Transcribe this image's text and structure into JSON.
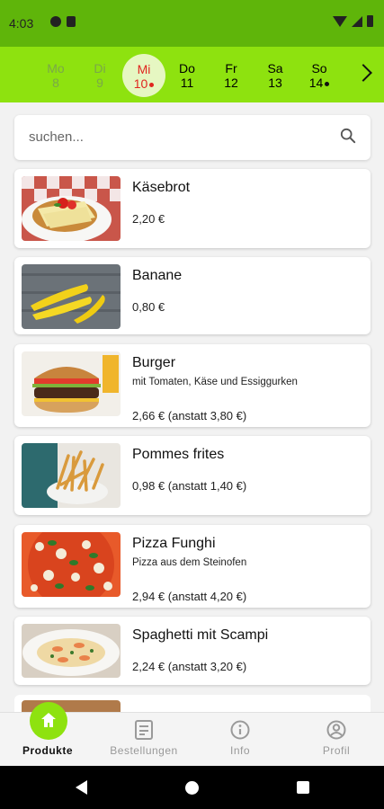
{
  "status_bar": {
    "time": "4:03"
  },
  "date_bar": {
    "days": [
      {
        "name": "Mo",
        "num": "8",
        "state": "past"
      },
      {
        "name": "Di",
        "num": "9",
        "state": "past"
      },
      {
        "name": "Mi",
        "num": "10",
        "state": "active",
        "dot_color": "#e0261f"
      },
      {
        "name": "Do",
        "num": "11",
        "state": "normal"
      },
      {
        "name": "Fr",
        "num": "12",
        "state": "normal"
      },
      {
        "name": "Sa",
        "num": "13",
        "state": "normal"
      },
      {
        "name": "So",
        "num": "14",
        "state": "normal",
        "dot_color": "#111111"
      }
    ]
  },
  "search": {
    "placeholder": "suchen..."
  },
  "products": [
    {
      "name": "Käsebrot",
      "description": "",
      "price": "2,20 €",
      "image": "cheese-bread"
    },
    {
      "name": "Banane",
      "description": "",
      "price": "0,80 €",
      "image": "bananas"
    },
    {
      "name": "Burger",
      "description": "mit Tomaten, Käse und Essiggurken",
      "price": "2,66 € (anstatt 3,80 €)",
      "image": "burger"
    },
    {
      "name": "Pommes frites",
      "description": "",
      "price": "0,98 € (anstatt 1,40 €)",
      "image": "fries"
    },
    {
      "name": "Pizza Funghi",
      "description": "Pizza aus dem Steinofen",
      "price": "2,94 € (anstatt 4,20 €)",
      "image": "pizza"
    },
    {
      "name": "Spaghetti mit Scampi",
      "description": "",
      "price": "2,24 € (anstatt 3,20 €)",
      "image": "spaghetti"
    }
  ],
  "bottom_nav": {
    "items": [
      {
        "label": "Produkte",
        "icon": "home-icon",
        "active": true
      },
      {
        "label": "Bestellungen",
        "icon": "receipt-icon",
        "active": false
      },
      {
        "label": "Info",
        "icon": "info-icon",
        "active": false
      },
      {
        "label": "Profil",
        "icon": "profile-icon",
        "active": false
      }
    ]
  },
  "colors": {
    "status_bar": "#5fb50a",
    "date_bar": "#8ee20f",
    "accent_red": "#e0261f"
  }
}
